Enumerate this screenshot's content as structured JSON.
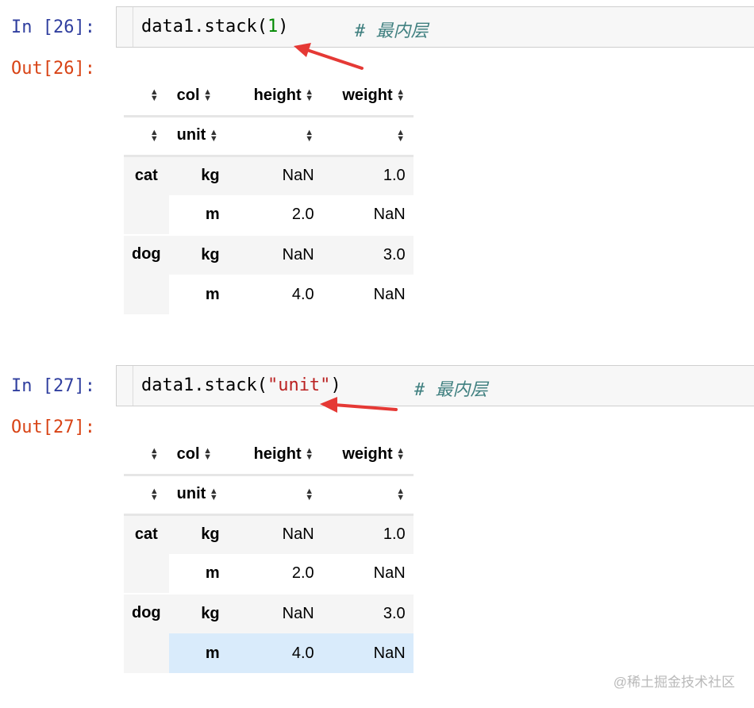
{
  "cells": [
    {
      "in_prompt": "In [26]:",
      "out_prompt": "Out[26]:",
      "code": {
        "prefix": "data1.stack(",
        "arg": "1",
        "arg_kind": "num",
        "suffix": ")",
        "comment": "# 最内层"
      },
      "table": {
        "header_row1": [
          "col",
          "height",
          "weight"
        ],
        "header_row2": [
          "unit",
          "",
          ""
        ],
        "rows": [
          {
            "outer": "cat",
            "inner": "kg",
            "height": "NaN",
            "weight": "1.0"
          },
          {
            "outer": "",
            "inner": "m",
            "height": "2.0",
            "weight": "NaN"
          },
          {
            "outer": "dog",
            "inner": "kg",
            "height": "NaN",
            "weight": "3.0"
          },
          {
            "outer": "",
            "inner": "m",
            "height": "4.0",
            "weight": "NaN"
          }
        ]
      }
    },
    {
      "in_prompt": "In [27]:",
      "out_prompt": "Out[27]:",
      "code": {
        "prefix": "data1.stack(",
        "arg": "\"unit\"",
        "arg_kind": "str",
        "suffix": ")",
        "comment": "# 最内层"
      },
      "table": {
        "header_row1": [
          "col",
          "height",
          "weight"
        ],
        "header_row2": [
          "unit",
          "",
          ""
        ],
        "rows": [
          {
            "outer": "cat",
            "inner": "kg",
            "height": "NaN",
            "weight": "1.0"
          },
          {
            "outer": "",
            "inner": "m",
            "height": "2.0",
            "weight": "NaN"
          },
          {
            "outer": "dog",
            "inner": "kg",
            "height": "NaN",
            "weight": "3.0"
          },
          {
            "outer": "",
            "inner": "m",
            "height": "4.0",
            "weight": "NaN"
          }
        ]
      }
    }
  ],
  "icons": {
    "sort": "sort-updown-icon",
    "annotation": "red-arrow-icon"
  },
  "colors": {
    "in_prompt": "#303f9f",
    "out_prompt": "#d84315",
    "comment": "#408080",
    "number": "#008800",
    "string": "#ba2121",
    "arrow": "#e53935",
    "hover_row": "#d9ebfb"
  },
  "watermark": "@稀土掘金技术社区"
}
